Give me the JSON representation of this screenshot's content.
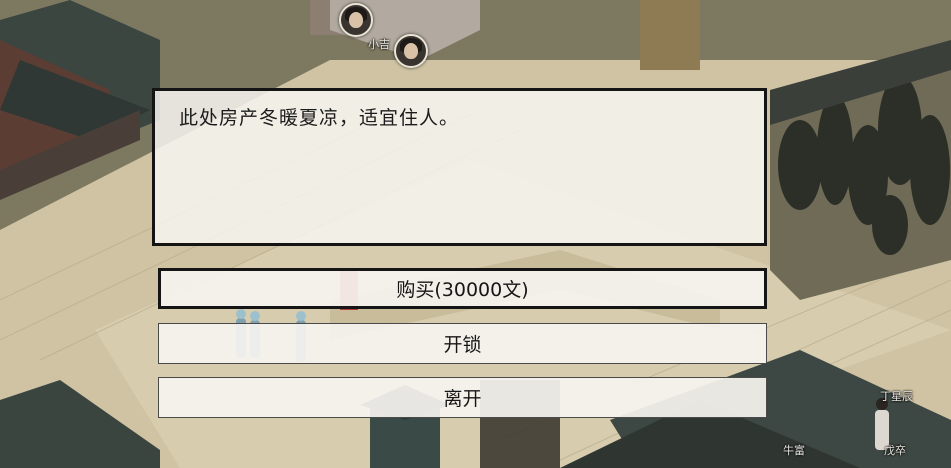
{
  "dialog": {
    "text": "此处房产冬暖夏凉，适宜住人。"
  },
  "options": [
    {
      "label": "购买(30000文)",
      "selected": true
    },
    {
      "label": "开锁",
      "selected": false
    },
    {
      "label": "离开",
      "selected": false
    }
  ],
  "npc_labels": {
    "top_npc": "小吉",
    "npc_ding": "丁星辰",
    "npc_niu": "牛富",
    "npc_wu": "戊卒"
  },
  "colors": {
    "dialog_bg": "#f6f4f0",
    "dialog_border": "#141414",
    "ground": "#d9cdb0",
    "roof": "#3f4a44"
  }
}
